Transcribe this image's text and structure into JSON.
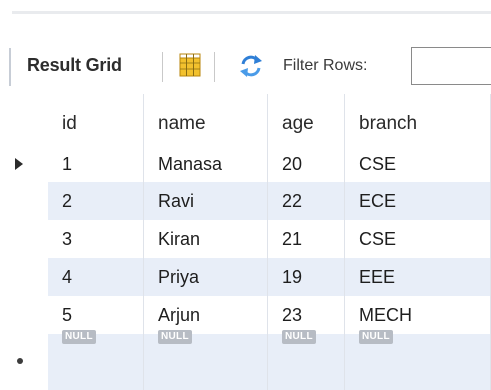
{
  "toolbar": {
    "result_grid_label": "Result Grid",
    "filter_label": "Filter Rows:",
    "filter_value": ""
  },
  "grid": {
    "columns": [
      "id",
      "name",
      "age",
      "branch"
    ],
    "rows": [
      [
        "1",
        "Manasa",
        "20",
        "CSE"
      ],
      [
        "2",
        "Ravi",
        "22",
        "ECE"
      ],
      [
        "3",
        "Kiran",
        "21",
        "CSE"
      ],
      [
        "4",
        "Priya",
        "19",
        "EEE"
      ],
      [
        "5",
        "Arjun",
        "23",
        "MECH"
      ]
    ],
    "null_row": [
      "NULL",
      "NULL",
      "NULL",
      "NULL"
    ]
  },
  "colors": {
    "stripe": "#e8eef8",
    "null_badge": "#b7bcc4",
    "layout_icon_yellow": "#f2c12e",
    "refresh_icon_blue": "#2f7fd6"
  },
  "icons": {
    "layout": "grid-layout-icon",
    "refresh": "refresh-icon",
    "current_row": "current-row-arrow-icon",
    "new_row": "new-row-marker-icon"
  }
}
